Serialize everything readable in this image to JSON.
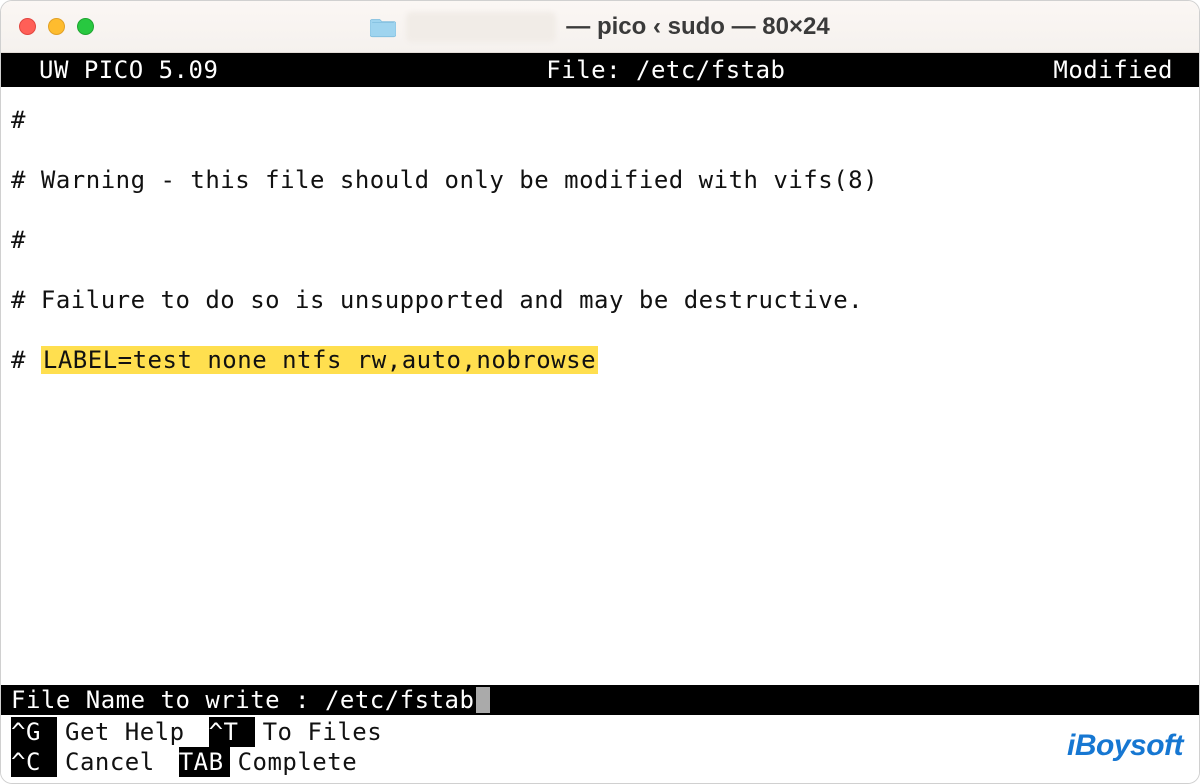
{
  "window": {
    "title_suffix": " — pico ‹ sudo — 80×24"
  },
  "status": {
    "left": "UW PICO 5.09",
    "mid_label": "File:",
    "mid_path": "/etc/fstab",
    "right": "Modified"
  },
  "editor": {
    "lines": [
      "#",
      "# Warning - this file should only be modified with vifs(8)",
      "#",
      "# Failure to do so is unsupported and may be destructive.",
      "#"
    ],
    "highlight_prefix": "# ",
    "highlight_text": "LABEL=test none ntfs rw,auto,nobrowse"
  },
  "prompt": {
    "label": "File Name to write :",
    "value": "/etc/fstab"
  },
  "shortcuts": {
    "row1": [
      {
        "key": "^G",
        "label": "Get Help"
      },
      {
        "key": "^T",
        "label": "To Files"
      }
    ],
    "row2": [
      {
        "key": "^C",
        "label": "Cancel"
      },
      {
        "key": "TAB",
        "label": "Complete"
      }
    ]
  },
  "watermark": "iBoysoft"
}
